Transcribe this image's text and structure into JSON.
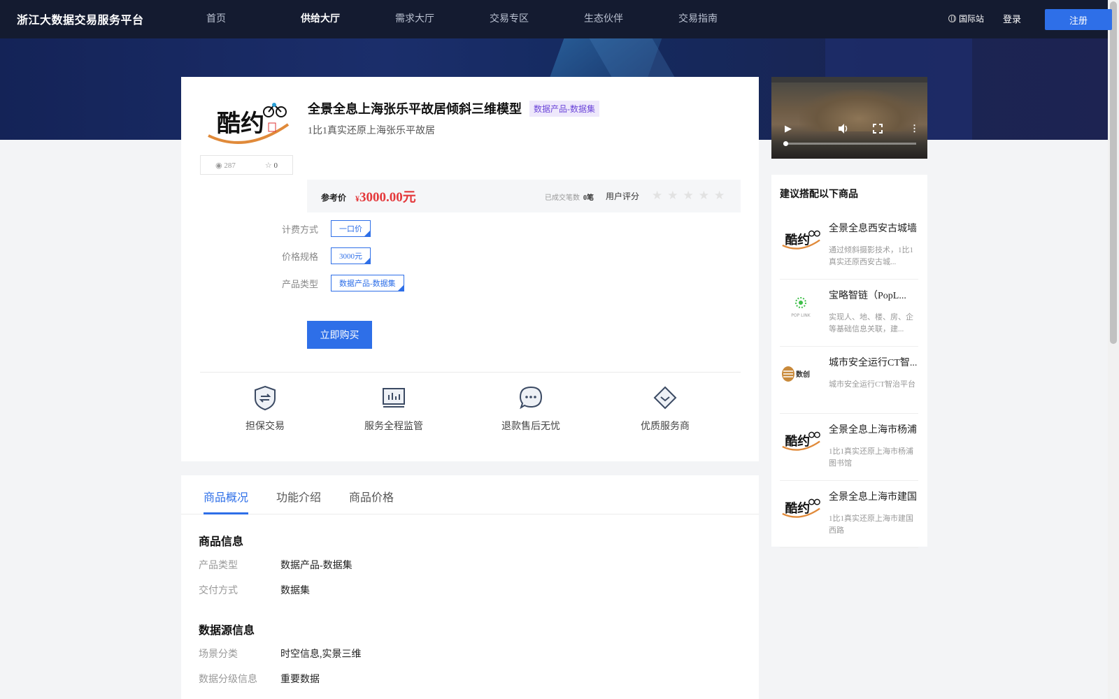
{
  "header": {
    "brand": "浙江大数据交易服务平台",
    "nav": [
      "首页",
      "供给大厅",
      "需求大厅",
      "交易专区",
      "生态伙伴",
      "交易指南"
    ],
    "active_index": 1,
    "intl": "国际站",
    "login": "登录",
    "register": "注册"
  },
  "product": {
    "title": "全景全息上海张乐平故居倾斜三维模型",
    "category_badge": "数据产品-数据集",
    "subtitle": "1比1真实还原上海张乐平故居",
    "views": "287",
    "favorites": "0",
    "price_label": "参考价",
    "price_symbol": "¥",
    "price": "3000.00元",
    "deals_label": "已成交笔数",
    "deals_count": "0笔",
    "rating_label": "用户评分",
    "rating_stars": "★★★★★",
    "options": [
      {
        "label": "计费方式",
        "value": "一口价"
      },
      {
        "label": "价格规格",
        "value": "3000元"
      },
      {
        "label": "产品类型",
        "value": "数据产品-数据集"
      }
    ],
    "buy_label": "立即购买",
    "features": [
      "担保交易",
      "服务全程监管",
      "退款售后无忧",
      "优质服务商"
    ]
  },
  "suggest": {
    "title": "建议搭配以下商品",
    "items": [
      {
        "name": "全景全息西安古城墙",
        "desc": "通过倾斜摄影技术，1比1真实还原西安古城..."
      },
      {
        "name": "宝略智链（PopL...",
        "desc": "实现人、地、楼、房、企等基础信息关联，建..."
      },
      {
        "name": "城市安全运行CT智...",
        "desc": "城市安全运行CT智治平台"
      },
      {
        "name": "全景全息上海市杨浦",
        "desc": "1比1真实还原上海市杨浦图书馆"
      },
      {
        "name": "全景全息上海市建国",
        "desc": "1比1真实还原上海市建国西路"
      }
    ]
  },
  "tabs": [
    "商品概况",
    "功能介绍",
    "商品价格"
  ],
  "details": {
    "section1_title": "商品信息",
    "section1": [
      {
        "k": "产品类型",
        "v": "数据产品-数据集"
      },
      {
        "k": "交付方式",
        "v": "数据集"
      }
    ],
    "section2_title": "数据源信息",
    "section2": [
      {
        "k": "场景分类",
        "v": "时空信息,实景三维"
      },
      {
        "k": "数据分级信息",
        "v": "重要数据"
      }
    ]
  },
  "colors": {
    "accent": "#2e6fe8",
    "price": "#e4393c",
    "header_bg": "#141b30",
    "badge_text": "#6b45d9"
  }
}
